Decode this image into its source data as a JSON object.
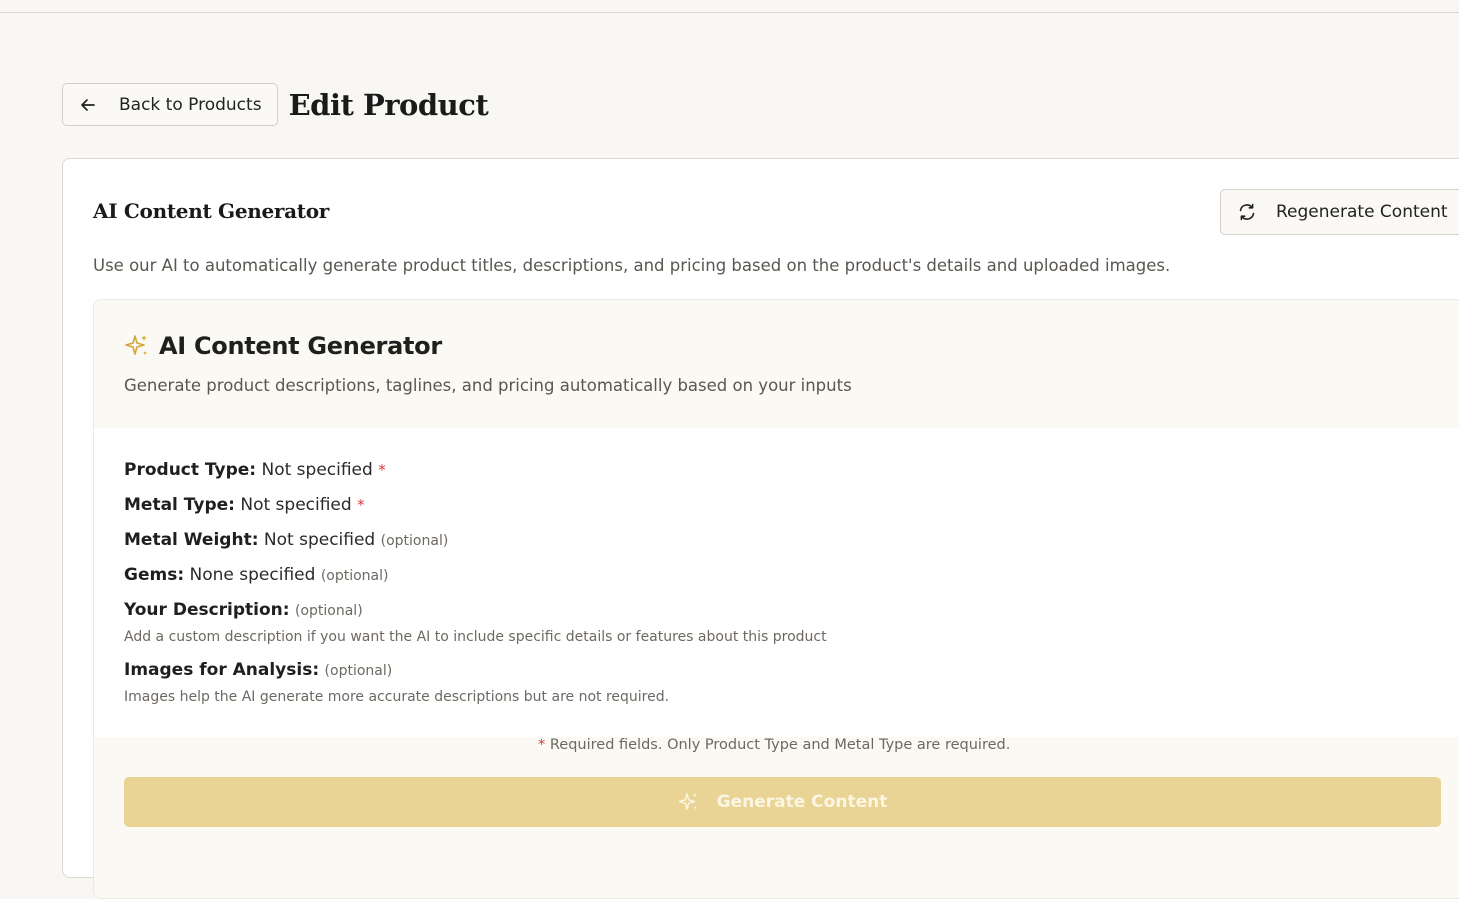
{
  "header": {
    "back_label": "Back to Products",
    "page_title": "Edit Product"
  },
  "card": {
    "title": "AI Content Generator",
    "regenerate_label": "Regenerate Content",
    "description": "Use our AI to automatically generate product titles, descriptions, and pricing based on the product's details and uploaded images."
  },
  "generator": {
    "title": "AI Content Generator",
    "subtitle": "Generate product descriptions, taglines, and pricing automatically based on your inputs",
    "fields": [
      {
        "label": "Product Type:",
        "value": "Not specified",
        "marker": "*"
      },
      {
        "label": "Metal Type:",
        "value": "Not specified",
        "marker": "*"
      },
      {
        "label": "Metal Weight:",
        "value": "Not specified",
        "marker": "(optional)"
      },
      {
        "label": "Gems:",
        "value": "None specified",
        "marker": "(optional)"
      },
      {
        "label": "Your Description:",
        "value": "",
        "marker": "(optional)",
        "hint": "Add a custom description if you want the AI to include specific details or features about this product"
      },
      {
        "label": "Images for Analysis:",
        "value": "",
        "marker": "(optional)",
        "hint": "Images help the AI generate more accurate descriptions but are not required."
      }
    ],
    "required_note_marker": "*",
    "required_note": "Required fields. Only Product Type and Metal Type are required.",
    "generate_label": "Generate Content"
  },
  "icons": {
    "back": "arrow-left-icon",
    "regenerate": "refresh-icon",
    "sparkle": "sparkle-icon"
  },
  "colors": {
    "accent": "#d4a537",
    "generate_button": "#e9d495",
    "required": "#d93b3b",
    "background": "#f8f7f3"
  }
}
